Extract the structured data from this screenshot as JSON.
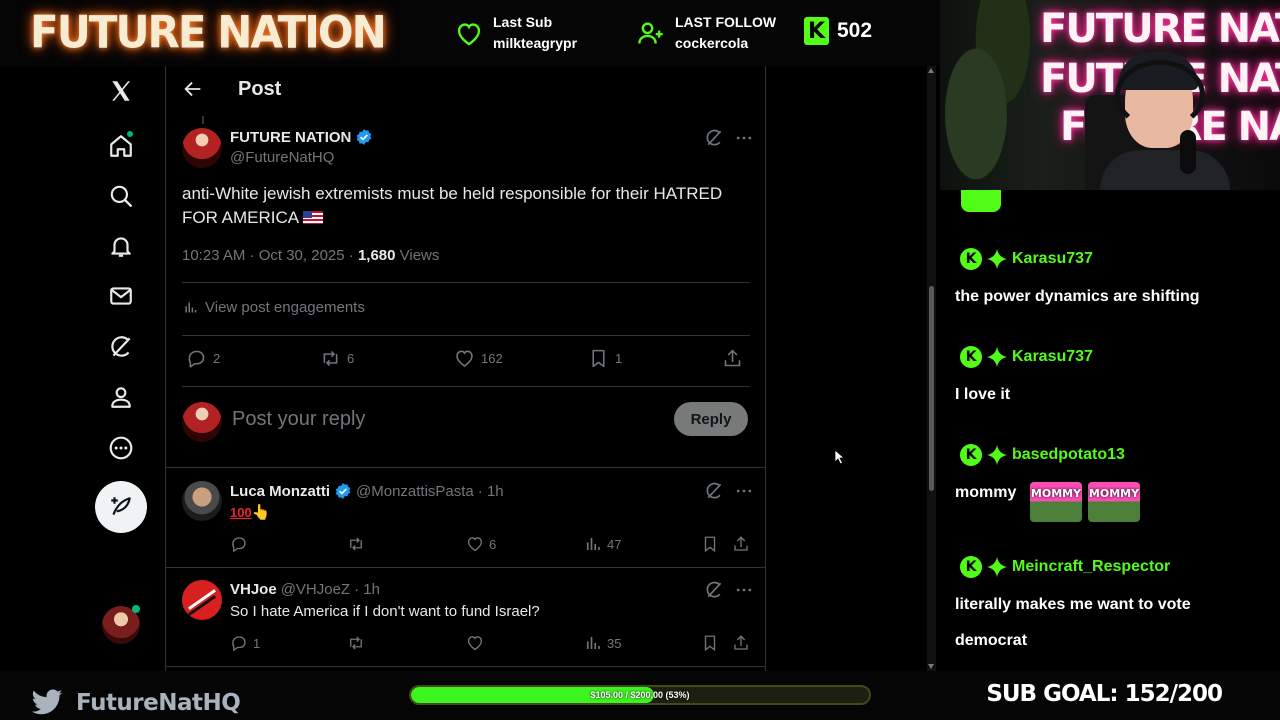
{
  "stream": {
    "brand": "FUTURE NATION",
    "last_sub_label": "Last Sub",
    "last_sub_user": "milkteagrypr",
    "last_follow_label": "LAST FOLLOW",
    "last_follow_user": "cockercola",
    "kick_badge": "K",
    "viewer_count": "502",
    "twitter_handle": "FutureNatHQ",
    "goal_text": "$105.00 / $200.00 (53%)",
    "goal_progress": 0.53,
    "sub_goal": "SUB GOAL: 152/200",
    "colors": {
      "kick_green": "#53fc18",
      "neon_orange": "#ff5a00",
      "neon_pink": "#ff1a8a"
    }
  },
  "webcam": {
    "neon_lines": [
      "FUTURE NATION",
      "FUTURE NATION",
      "FUTURE NATION"
    ]
  },
  "x": {
    "nav_icons": [
      "x-logo-icon",
      "home-icon",
      "search-icon",
      "notifications-icon",
      "messages-icon",
      "grok-icon",
      "profile-icon",
      "more-icon",
      "compose-icon"
    ],
    "header_title": "Post",
    "post": {
      "author_name": "FUTURE NATION",
      "author_handle": "@FutureNatHQ",
      "text": "anti-White jewish extremists must be held responsible for their HATRED FOR AMERICA",
      "timestamp": "10:23 AM · Oct 30, 2025 · ",
      "views_count": "1,680",
      "views_label": " Views",
      "engagements": "View post engagements",
      "replies": "2",
      "reposts": "6",
      "likes": "162",
      "bookmarks": "1"
    },
    "reply_composer": {
      "placeholder": "Post your reply",
      "button": "Reply"
    },
    "replies": [
      {
        "name": "Luca Monzatti",
        "handle": "@MonzattisPasta",
        "time": "· 1h",
        "text": "👆",
        "emoji_100": "100",
        "replies": "",
        "reposts": "",
        "likes": "6",
        "views": "47"
      },
      {
        "name": "VHJoe",
        "handle": "@VHJoeZ",
        "time": "· 1h",
        "text": "So I hate America if I don't want to fund Israel?",
        "replies": "1",
        "reposts": "",
        "likes": "",
        "views": "35"
      }
    ]
  },
  "chat": {
    "messages": [
      {
        "user": "Karasu737",
        "text": "the power dynamics are shifting"
      },
      {
        "user": "Karasu737",
        "text": "I love it"
      },
      {
        "user": "basedpotato13",
        "text": "mommy"
      },
      {
        "user": "Meincraft_Respector",
        "text": "literally makes me want to vote democrat"
      }
    ],
    "emote_label": "MOMMY"
  }
}
